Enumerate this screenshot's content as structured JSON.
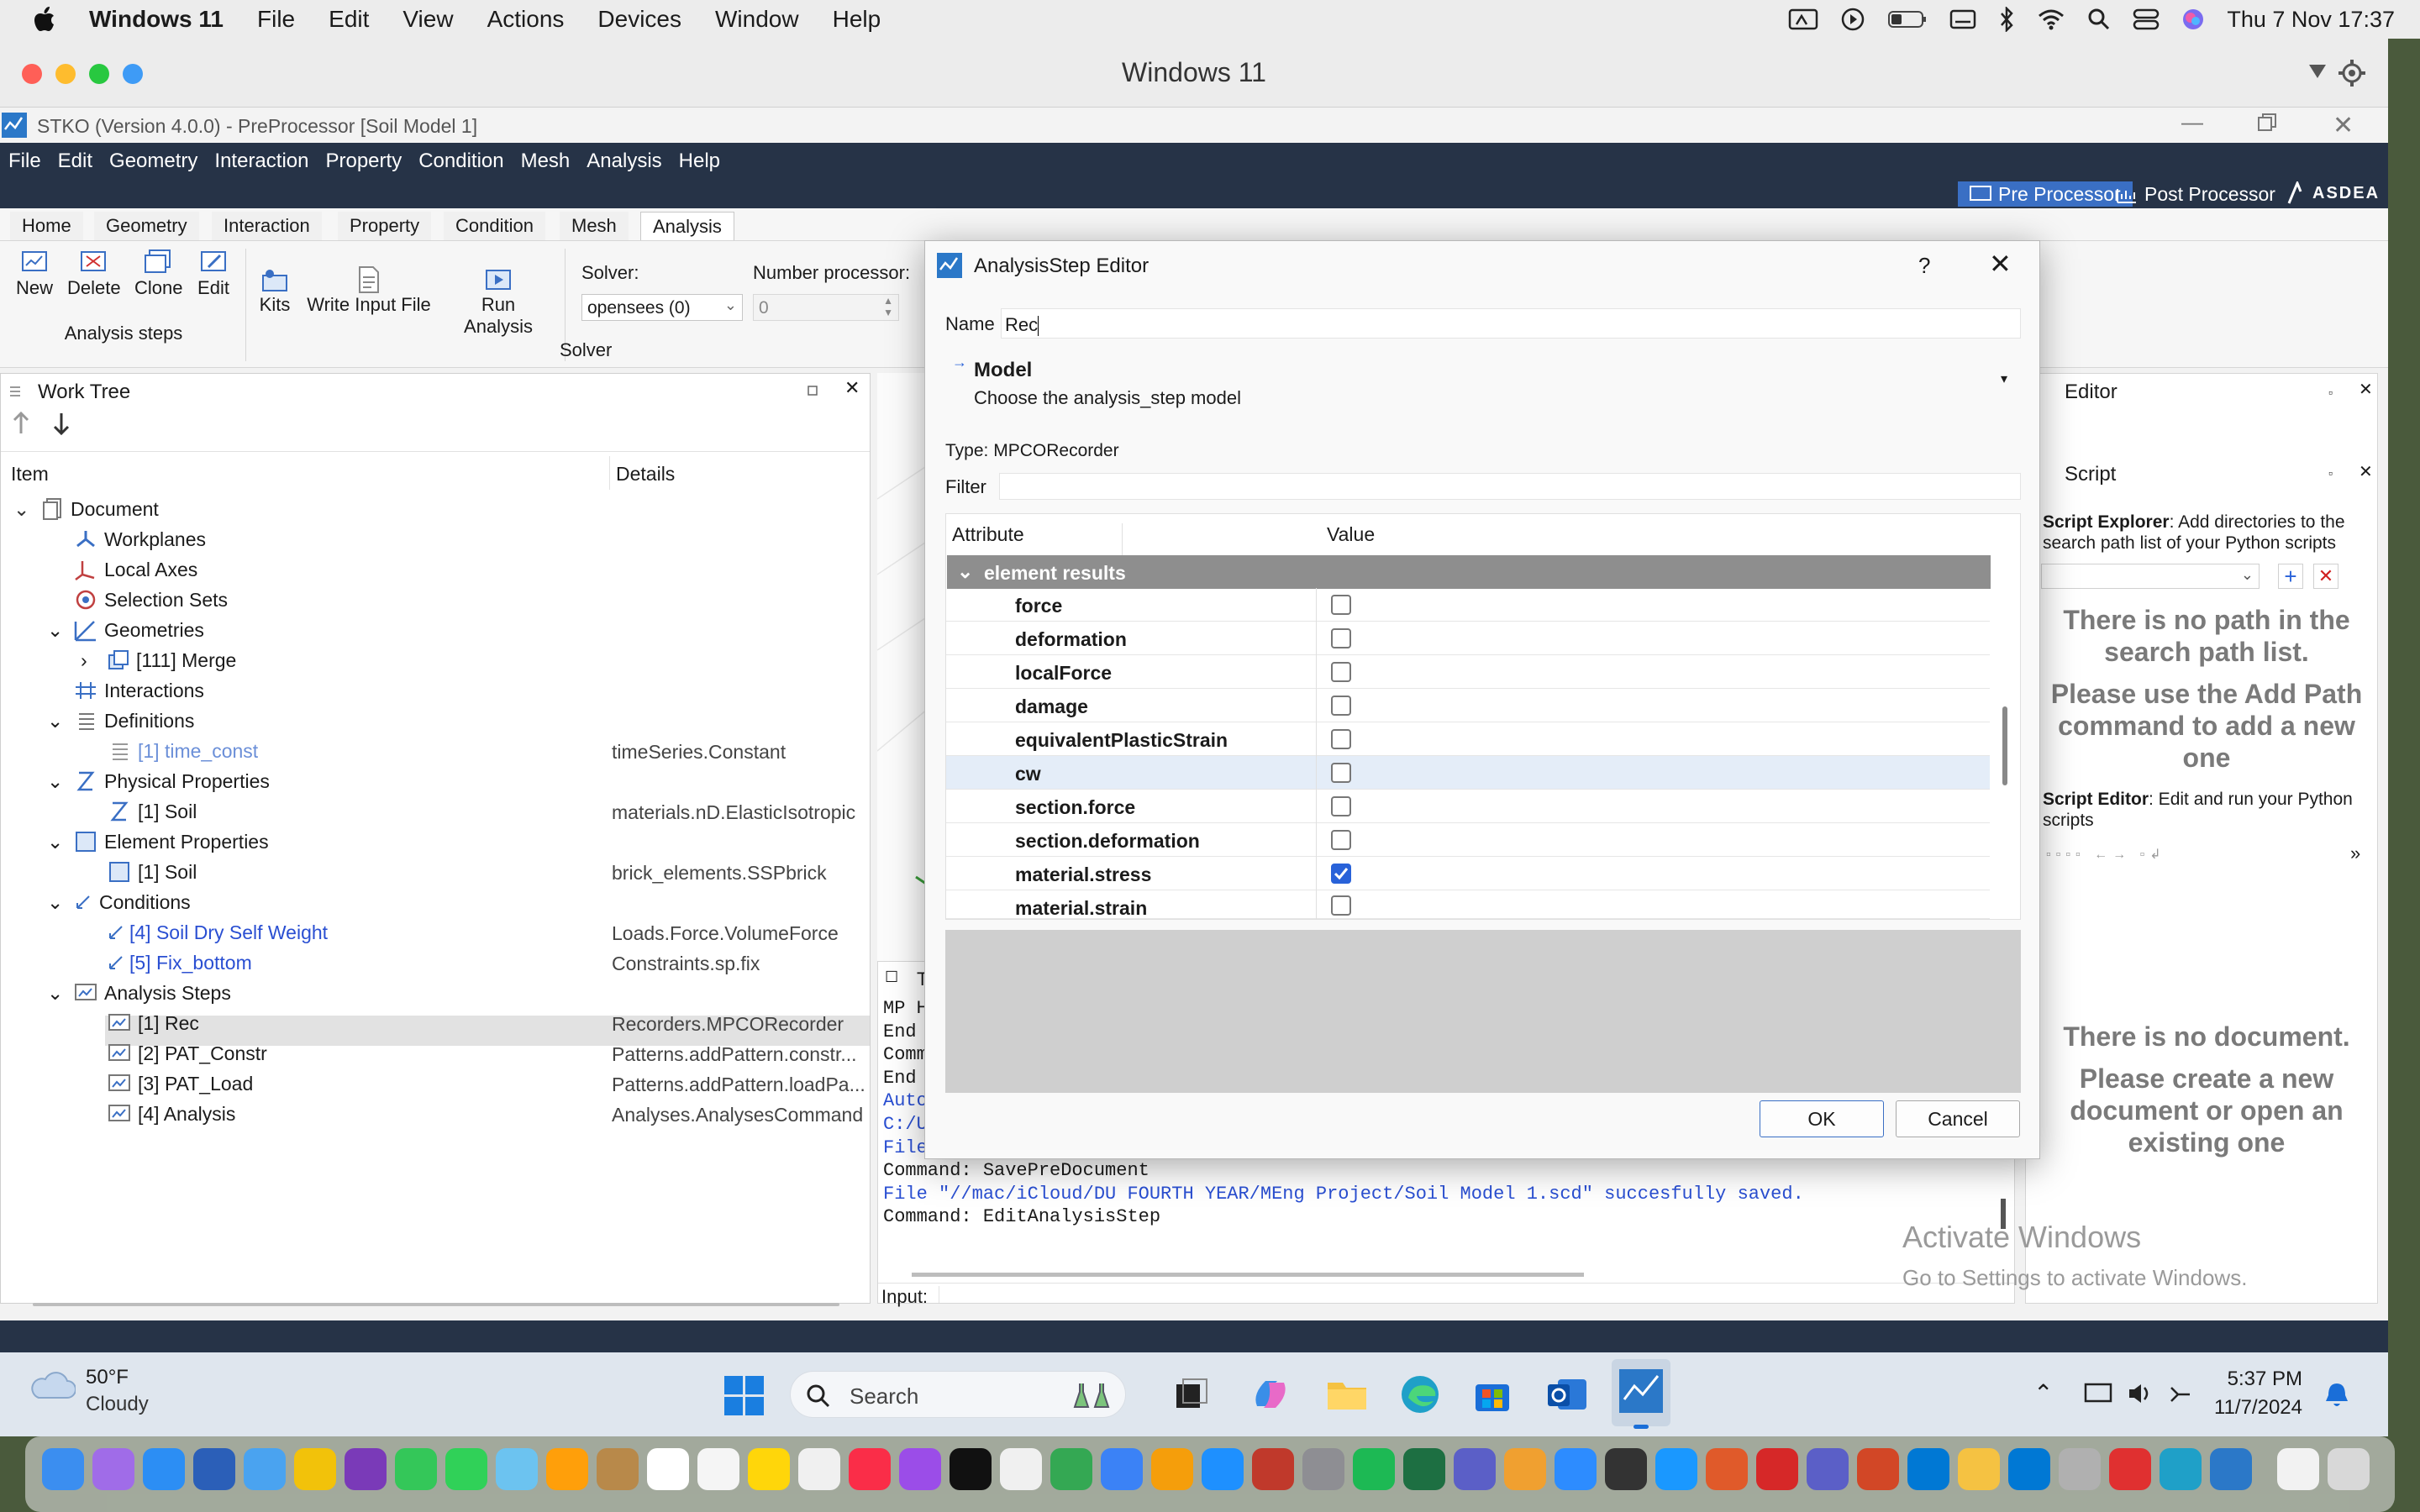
{
  "mac": {
    "app": "Windows 11",
    "menu": [
      "File",
      "Edit",
      "View",
      "Actions",
      "Devices",
      "Window",
      "Help"
    ],
    "clock": "Thu 7 Nov  17:37"
  },
  "vm": {
    "title": "Windows 11"
  },
  "stko": {
    "title": "STKO (Version 4.0.0) - PreProcessor [Soil Model 1]",
    "menu": [
      "File",
      "Edit",
      "Geometry",
      "Interaction",
      "Property",
      "Condition",
      "Mesh",
      "Analysis",
      "Help"
    ],
    "modes": {
      "pre": "Pre Processor",
      "post": "Post Processor",
      "logo": "ASDEA"
    },
    "tabs": [
      "Home",
      "Geometry",
      "Interaction",
      "Property",
      "Condition",
      "Mesh",
      "Analysis"
    ],
    "ribbon": {
      "new": "New",
      "delete": "Delete",
      "clone": "Clone",
      "edit": "Edit",
      "group1": "Analysis steps",
      "kits": "Kits",
      "write": "Write Input File",
      "run": "Run Analysis",
      "solver_label": "Solver:",
      "solver_value": "opensees (0)",
      "nproc_label": "Number processor:",
      "nproc_value": "0",
      "group2": "Solver"
    }
  },
  "worktree": {
    "title": "Work Tree",
    "col_item": "Item",
    "col_details": "Details",
    "rows": [
      {
        "label": "Document",
        "details": ""
      },
      {
        "label": "Workplanes",
        "details": ""
      },
      {
        "label": "Local Axes",
        "details": ""
      },
      {
        "label": "Selection Sets",
        "details": ""
      },
      {
        "label": "Geometries",
        "details": ""
      },
      {
        "label": "[111] Merge",
        "details": ""
      },
      {
        "label": "Interactions",
        "details": ""
      },
      {
        "label": "Definitions",
        "details": ""
      },
      {
        "label": "[1] time_const",
        "details": "timeSeries.Constant"
      },
      {
        "label": "Physical Properties",
        "details": ""
      },
      {
        "label": "[1] Soil",
        "details": "materials.nD.ElasticIsotropic"
      },
      {
        "label": "Element Properties",
        "details": ""
      },
      {
        "label": "[1] Soil",
        "details": "brick_elements.SSPbrick"
      },
      {
        "label": "Conditions",
        "details": ""
      },
      {
        "label": "[4] Soil Dry Self Weight",
        "details": "Loads.Force.VolumeForce"
      },
      {
        "label": "[5] Fix_bottom",
        "details": "Constraints.sp.fix"
      },
      {
        "label": "Analysis Steps",
        "details": ""
      },
      {
        "label": "[1] Rec",
        "details": "Recorders.MPCORecorder"
      },
      {
        "label": "[2] PAT_Constr",
        "details": "Patterns.addPattern.constr..."
      },
      {
        "label": "[3] PAT_Load",
        "details": "Patterns.addPattern.loadPa..."
      },
      {
        "label": "[4] Analysis",
        "details": "Analyses.AnalysesCommand"
      }
    ]
  },
  "terminal": {
    "lines": [
      "MP H",
      "End ",
      "Comm",
      "End ",
      "Auto",
      "C:/U",
      "File",
      "Command: SavePreDocument",
      "File \"//mac/iCloud/DU FOURTH YEAR/MEng Project/Soil Model 1.scd\" succesfully saved.",
      "Command: EditAnalysisStep"
    ],
    "tab": "T",
    "input_label": "Input:"
  },
  "editor": {
    "title": "Editor",
    "script_title": "Script",
    "explorer_bold": "Script Explorer",
    "explorer_text": ": Add directories to the search path list of your Python scripts",
    "nopath1": "There is no path in the search path list.",
    "nopath2": "Please use the Add Path command to add a new one",
    "seditor_bold": "Script Editor",
    "seditor_text": ": Edit and run your Python scripts",
    "nodoc1": "There is no document.",
    "nodoc2": "Please create a new document or open an existing one",
    "activate1": "Activate Windows",
    "activate2": "Go to Settings to activate Windows."
  },
  "dialog": {
    "title": "AnalysisStep Editor",
    "help": "?",
    "name_label": "Name",
    "name_value": "Rec",
    "model_title": "Model",
    "model_desc": "Choose the analysis_step model",
    "type_label": "Type:",
    "type_value": "MPCORecorder",
    "filter_label": "Filter",
    "col_attr": "Attribute",
    "col_value": "Value",
    "group": "element results",
    "attrs": [
      {
        "name": "force",
        "checked": false
      },
      {
        "name": "deformation",
        "checked": false
      },
      {
        "name": "localForce",
        "checked": false
      },
      {
        "name": "damage",
        "checked": false
      },
      {
        "name": "equivalentPlasticStrain",
        "checked": false
      },
      {
        "name": "cw",
        "checked": false
      },
      {
        "name": "section.force",
        "checked": false
      },
      {
        "name": "section.deformation",
        "checked": false
      },
      {
        "name": "material.stress",
        "checked": true
      },
      {
        "name": "material.strain",
        "checked": false
      }
    ],
    "ok": "OK",
    "cancel": "Cancel"
  },
  "taskbar": {
    "temp": "50°F",
    "weather": "Cloudy",
    "search": "Search",
    "time": "5:37 PM",
    "date": "11/7/2024"
  },
  "colors": {
    "stko_bar": "#263347",
    "accent": "#2962d9",
    "link": "#2a4fd2"
  }
}
